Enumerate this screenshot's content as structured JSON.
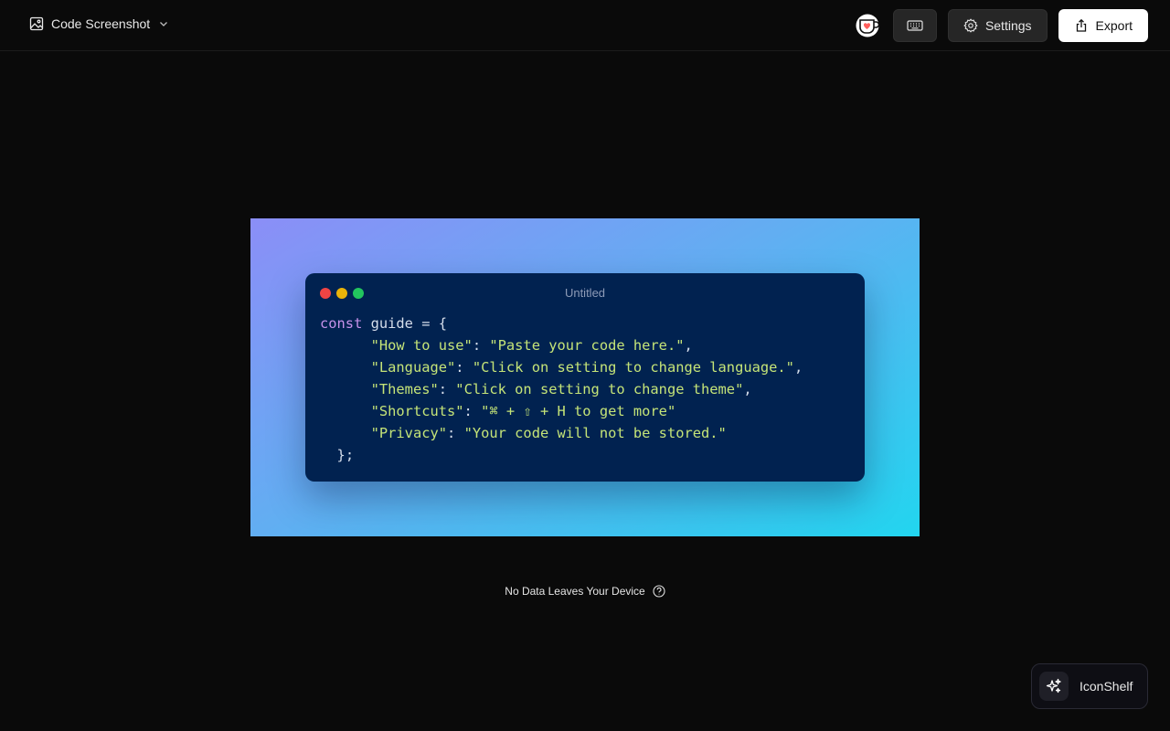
{
  "header": {
    "app_title": "Code Screenshot",
    "app_icon": "image-icon",
    "settings_label": "Settings",
    "export_label": "Export"
  },
  "window": {
    "title": "Untitled",
    "dot_colors": [
      "#ef4444",
      "#eab308",
      "#22c55e"
    ]
  },
  "code": {
    "language": "javascript",
    "lines": [
      [
        "const",
        " guide = {"
      ],
      [
        "\"How to use\"",
        ": ",
        "\"Paste your code here.\"",
        ","
      ],
      [
        "\"Language\"",
        ": ",
        "\"Click on setting to change language.\"",
        ","
      ],
      [
        "\"Themes\"",
        ": ",
        "\"Click on setting to change theme\"",
        ","
      ],
      [
        "\"Shortcuts\"",
        ": ",
        "\"⌘ + ⇧ + H to get more\""
      ],
      [
        "\"Privacy\"",
        ": ",
        "\"Your code will not be stored.\""
      ],
      [
        "};"
      ]
    ]
  },
  "footer": {
    "note": "No Data Leaves Your Device"
  },
  "widget": {
    "label": "IconShelf"
  },
  "colors": {
    "background": "#0a0a0a",
    "window_bg": "#012250",
    "gradient": [
      "#8b8ef7",
      "#62aef2",
      "#22d5ef"
    ],
    "keyword": "#c792ea",
    "string": "#c5e478"
  }
}
